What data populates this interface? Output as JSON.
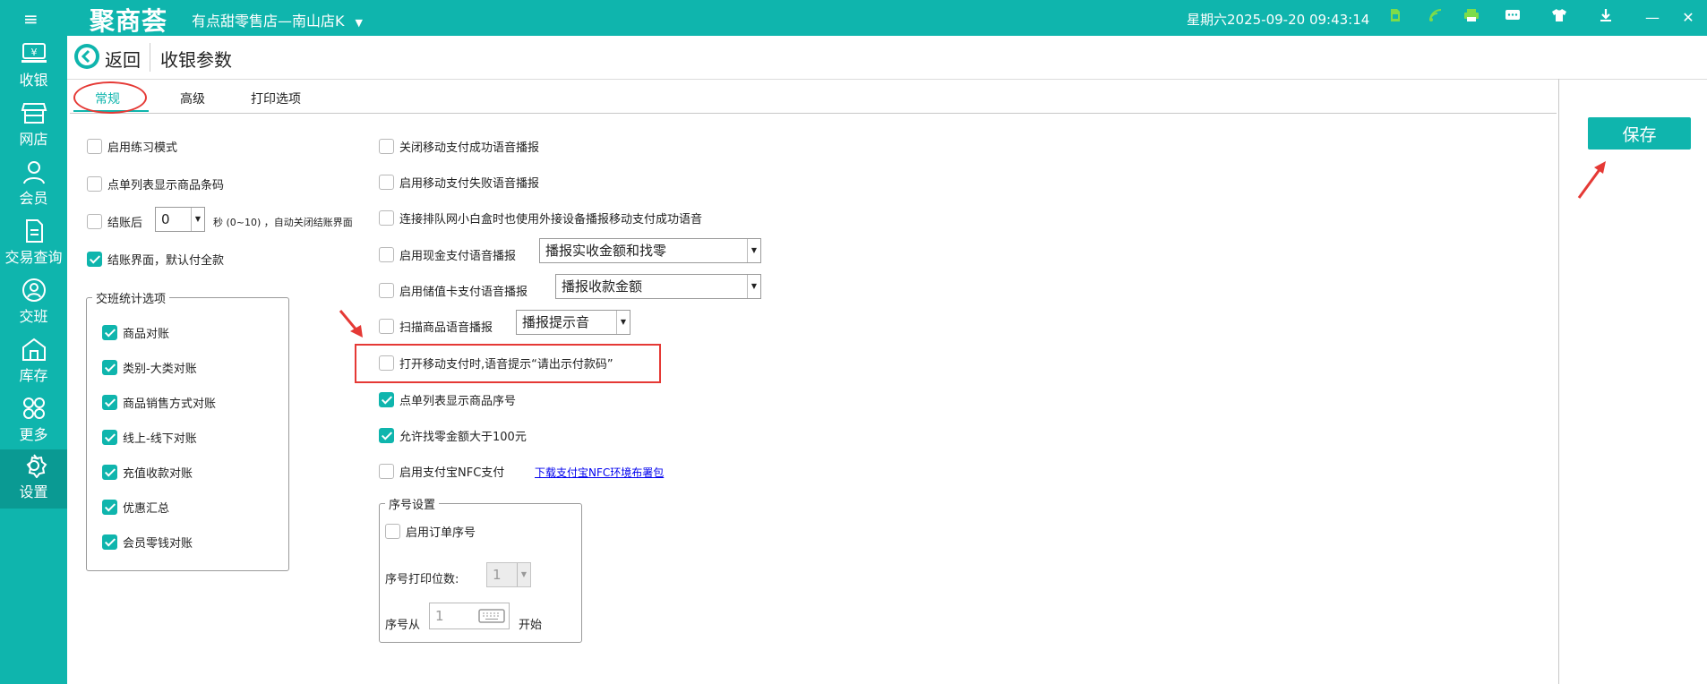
{
  "app": {
    "logo": "聚商荟",
    "store_name": "有点甜零售店—南山店K",
    "datetime": "星期六2025-09-20 09:43:14",
    "accent_color": "#0fb5ad"
  },
  "topbar_icons": [
    "menu-icon",
    "sim-card-icon",
    "wifi-icon",
    "printer-icon",
    "chat-icon",
    "tshirt-icon",
    "download-icon",
    "minimize-icon",
    "close-icon"
  ],
  "sidebar": {
    "items": [
      {
        "label": "收银",
        "icon": "cashier-icon"
      },
      {
        "label": "网店",
        "icon": "shop-icon"
      },
      {
        "label": "会员",
        "icon": "member-icon"
      },
      {
        "label": "交易查询",
        "icon": "document-icon"
      },
      {
        "label": "交班",
        "icon": "handover-icon"
      },
      {
        "label": "库存",
        "icon": "warehouse-icon"
      },
      {
        "label": "更多",
        "icon": "grid-icon"
      },
      {
        "label": "设置",
        "icon": "gear-icon",
        "active": true
      }
    ]
  },
  "header": {
    "back_label": "返回",
    "title": "收银参数"
  },
  "tabs": [
    {
      "label": "常规",
      "active": true
    },
    {
      "label": "高级"
    },
    {
      "label": "打印选项"
    }
  ],
  "save_label": "保存",
  "left": {
    "practice_mode": {
      "label": "启用练习模式",
      "checked": false
    },
    "show_barcode": {
      "label": "点单列表显示商品条码",
      "checked": false
    },
    "auto_close": {
      "label": "结账后",
      "value": "0",
      "suffix": "秒 (0~10) ，自动关闭结账界面",
      "checked": false
    },
    "default_full": {
      "label": "结账界面，默认付全款",
      "checked": true
    },
    "shift_group": {
      "title": "交班统计选项",
      "items": [
        {
          "label": "商品对账",
          "checked": true
        },
        {
          "label": "类别-大类对账",
          "checked": true
        },
        {
          "label": "商品销售方式对账",
          "checked": true
        },
        {
          "label": "线上-线下对账",
          "checked": true
        },
        {
          "label": "充值收款对账",
          "checked": true
        },
        {
          "label": "优惠汇总",
          "checked": true
        },
        {
          "label": "会员零钱对账",
          "checked": true
        }
      ]
    }
  },
  "right": {
    "items": [
      {
        "label": "关闭移动支付成功语音播报",
        "checked": false
      },
      {
        "label": "启用移动支付失败语音播报",
        "checked": false
      },
      {
        "label": "连接排队网小白盒时也使用外接设备播报移动支付成功语音",
        "checked": false
      },
      {
        "label": "启用现金支付语音播报",
        "checked": false,
        "select": "播报实收金额和找零"
      },
      {
        "label": "启用储值卡支付语音播报",
        "checked": false,
        "select": "播报收款金额"
      },
      {
        "label": "扫描商品语音播报",
        "checked": false,
        "select": "播报提示音"
      },
      {
        "label": "打开移动支付时,语音提示“请出示付款码”",
        "checked": false
      },
      {
        "label": "点单列表显示商品序号",
        "checked": true
      },
      {
        "label": "允许找零金额大于100元",
        "checked": true
      },
      {
        "label": "启用支付宝NFC支付",
        "checked": false,
        "link": "下载支付宝NFC环境布署包"
      }
    ],
    "serial_group": {
      "title": "序号设置",
      "enable_label": "启用订单序号",
      "enable_checked": false,
      "digits_label": "序号打印位数:",
      "digits_value": "1",
      "start_label_prefix": "序号从",
      "start_value": "1",
      "start_label_suffix": "开始"
    }
  }
}
